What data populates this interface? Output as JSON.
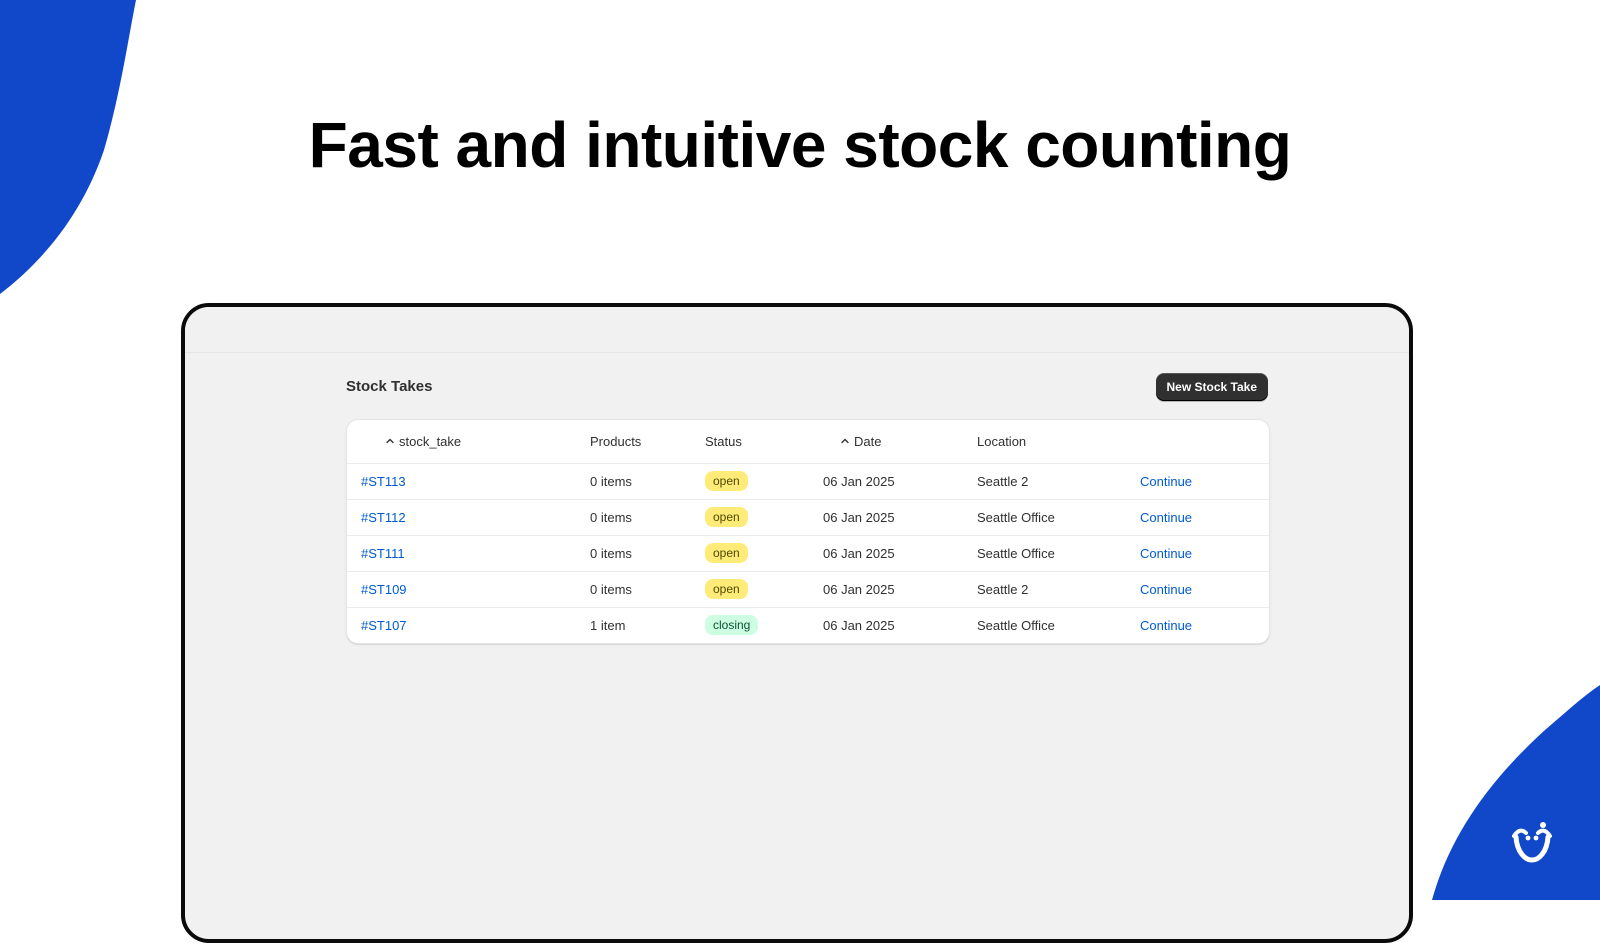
{
  "headline": "Fast and intuitive stock counting",
  "colors": {
    "brand_blue": "#1148c9",
    "screen_background": "#f1f1f1",
    "primary_button": "#303030",
    "link": "#005bd3",
    "badge_open": "#ffeb78",
    "badge_closing": "#cdfee1"
  },
  "page": {
    "title": "Stock Takes",
    "primary_action_label": "New Stock Take"
  },
  "table": {
    "columns": {
      "stock_take": "stock_take",
      "products": "Products",
      "status": "Status",
      "date": "Date",
      "location": "Location"
    },
    "sort_icons": {
      "stock_take": "chevron-up-icon",
      "date": "chevron-up-icon"
    },
    "rows": [
      {
        "id": "#ST113",
        "products": "0 items",
        "status": "open",
        "date": "06 Jan 2025",
        "location": "Seattle 2",
        "action": "Continue"
      },
      {
        "id": "#ST112",
        "products": "0 items",
        "status": "open",
        "date": "06 Jan 2025",
        "location": "Seattle Office",
        "action": "Continue"
      },
      {
        "id": "#ST111",
        "products": "0 items",
        "status": "open",
        "date": "06 Jan 2025",
        "location": "Seattle Office",
        "action": "Continue"
      },
      {
        "id": "#ST109",
        "products": "0 items",
        "status": "open",
        "date": "06 Jan 2025",
        "location": "Seattle 2",
        "action": "Continue"
      },
      {
        "id": "#ST107",
        "products": "1 item",
        "status": "closing",
        "date": "06 Jan 2025",
        "location": "Seattle Office",
        "action": "Continue"
      }
    ]
  },
  "brand": {
    "logo_icon": "smiling-face-icon"
  }
}
